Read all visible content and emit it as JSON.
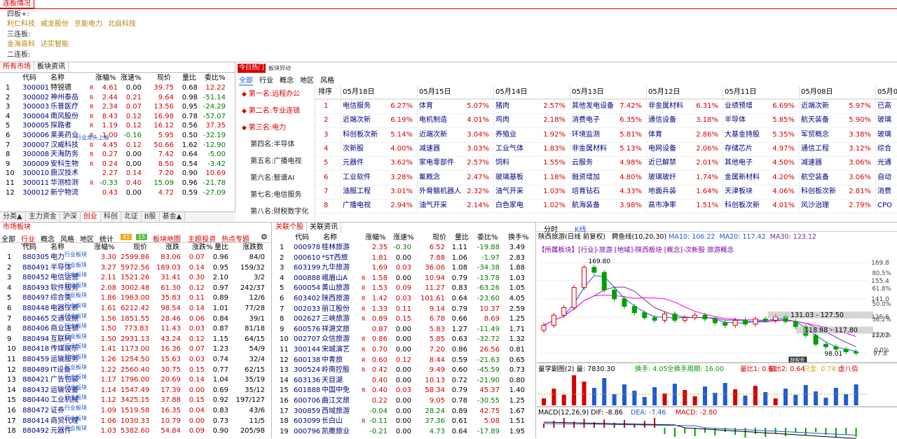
{
  "lianban": {
    "title": "连板情况",
    "rows": [
      {
        "label": "四板+:",
        "stocks": [
          "利仁科技",
          "威龙股份",
          "京能电力",
          "北自科技"
        ]
      },
      {
        "label": "三连板:",
        "stocks": [
          "金海高科",
          "达实智能"
        ]
      },
      {
        "label": "二连板:",
        "stocks": []
      }
    ]
  },
  "market": {
    "tabs": [
      "所有市场",
      "板块资讯"
    ],
    "headers": [
      "代码",
      "名称",
      "涨幅%",
      "涨速%",
      "现价",
      "量比",
      "委比%"
    ],
    "rows": [
      [
        "1",
        "300001",
        "特锐德",
        "R",
        "4.61",
        "0.00",
        "39.75",
        "0.68",
        "12.22"
      ],
      [
        "2",
        "300002",
        "神州泰岳",
        "R",
        "2.44",
        "0.21",
        "9.64",
        "0.98",
        "-51.14"
      ],
      [
        "3",
        "300003",
        "乐普医疗",
        "R",
        "2.34",
        "0.07",
        "13.56",
        "0.95",
        "-24.29"
      ],
      [
        "4",
        "300004",
        "南风股份",
        "R",
        "8.43",
        "0.12",
        "16.98",
        "0.78",
        "-57.07"
      ],
      [
        "5",
        "300005",
        "探路者",
        "R",
        "1.19",
        "0.12",
        "16.12",
        "0.56",
        "37.35"
      ],
      [
        "6",
        "300006",
        "莱美药业",
        "R",
        "1.00",
        "-0.16",
        "5.95",
        "0.50",
        "-32.19"
      ],
      [
        "7",
        "300007",
        "汉威科技",
        "R",
        "4.45",
        "0.12",
        "50.66",
        "1.62",
        "-12.90"
      ],
      [
        "8",
        "300008",
        "天海防务",
        "R",
        "0.27",
        "0.00",
        "7.42",
        "0.64",
        "-5.00"
      ],
      [
        "9",
        "300009",
        "安科生物",
        "R",
        "0.24",
        "0.00",
        "8.50",
        "0.54",
        "-3.42"
      ],
      [
        "10",
        "300010",
        "鼎汉技术",
        "",
        "2.27",
        "0.14",
        "7.20",
        "0.90",
        "10.69"
      ],
      [
        "11",
        "300011",
        "华测检测",
        "R",
        "-0.33",
        "0.40",
        "15.09",
        "0.96",
        "-21.78"
      ],
      [
        "12",
        "300012",
        "新宁物流",
        "",
        "0.43",
        "0.00",
        "4.72",
        "0.59",
        "-27.09"
      ]
    ],
    "hot_tag": "行业龙头上板",
    "bottom_tabs": [
      "分类▲",
      "主力资金",
      "沪深",
      "创业",
      "科创",
      "北证",
      "B股",
      "基金▲"
    ]
  },
  "hot": {
    "tab_active": "今日热门",
    "tab_other": "板块异动",
    "filters": [
      "全部",
      "行业",
      "概念",
      "地区",
      "风格"
    ],
    "ranks": [
      "第一名:远程办公",
      "第二名:专业连锁",
      "第三名:电力",
      "第四名:半导体",
      "第五名:广播电视",
      "第六名:智谱AI",
      "第七名:电信服务",
      "第八名:财税数字化"
    ],
    "rank_header": "排序",
    "dates": [
      "05月18日",
      "05月15日",
      "05月14日",
      "05月13日",
      "05月12日",
      "05月11日",
      "05月08日",
      "05月0"
    ],
    "rows": [
      [
        [
          "电信服务",
          "6.27%"
        ],
        [
          "体育",
          "5.07%"
        ],
        [
          "猪肉",
          "2.57%"
        ],
        [
          "其他发电设备",
          "7.42%"
        ],
        [
          "非金属材料",
          "6.31%"
        ],
        [
          "业绩预增",
          "6.69%"
        ],
        [
          "近端次新",
          "5.97%"
        ],
        [
          "已高"
        ]
      ],
      [
        [
          "近端次新",
          "6.19%"
        ],
        [
          "电机制造",
          "4.01%"
        ],
        [
          "鸡肉",
          "2.18%"
        ],
        [
          "消费电子",
          "6.35%"
        ],
        [
          "通信设备",
          "3.18%"
        ],
        [
          "半导体",
          "5.85%"
        ],
        [
          "航天装备",
          "5.90%"
        ],
        [
          "玻璃"
        ]
      ],
      [
        [
          "科创板次新",
          "5.14%"
        ],
        [
          "近端次新",
          "3.04%"
        ],
        [
          "养殖业",
          "1.92%"
        ],
        [
          "环境监测",
          "5.81%"
        ],
        [
          "体育",
          "2.86%"
        ],
        [
          "大基金持股",
          "5.35%"
        ],
        [
          "军贸概念",
          "3.38%"
        ],
        [
          "玻璃"
        ]
      ],
      [
        [
          "次新股",
          "4.00%"
        ],
        [
          "减速器",
          "3.03%"
        ],
        [
          "工业气体",
          "1.83%"
        ],
        [
          "非金属材料",
          "5.13%"
        ],
        [
          "电网设备",
          "2.06%"
        ],
        [
          "存储芯片",
          "4.97%"
        ],
        [
          "通信工程",
          "3.12%"
        ],
        [
          "综合"
        ]
      ],
      [
        [
          "元器件",
          "3.62%"
        ],
        [
          "家电零部件",
          "2.57%"
        ],
        [
          "饲料",
          "1.55%"
        ],
        [
          "云服务",
          "4.98%"
        ],
        [
          "近已解禁",
          "2.01%"
        ],
        [
          "其他电子",
          "4.50%"
        ],
        [
          "减速器",
          "3.06%"
        ],
        [
          "光通"
        ]
      ],
      [
        [
          "工业软件",
          "3.28%"
        ],
        [
          "氟概念",
          "2.47%"
        ],
        [
          "玻璃基板",
          "1.18%"
        ],
        [
          "融资增加",
          "4.80%"
        ],
        [
          "玻璃玻纤",
          "1.74%"
        ],
        [
          "金属新材料",
          "4.20%"
        ],
        [
          "航空装备",
          "3.06%"
        ],
        [
          "自动"
        ]
      ],
      [
        [
          "油服工程",
          "3.01%"
        ],
        [
          "外骨骼机器人",
          "2.32%"
        ],
        [
          "油气开采",
          "1.03%"
        ],
        [
          "培育钻石",
          "4.33%"
        ],
        [
          "地面兵装",
          "1.64%"
        ],
        [
          "天津板块",
          "4.06%"
        ],
        [
          "科创板次新",
          "2.81%"
        ],
        [
          "消费"
        ]
      ],
      [
        [
          "广播电视",
          "2.94%"
        ],
        [
          "油气开采",
          "2.14%"
        ],
        [
          "白色家电",
          "1.02%"
        ],
        [
          "航海装备",
          "3.98%"
        ],
        [
          "高市净率",
          "1.51%"
        ],
        [
          "科创板次新",
          "4.01%"
        ],
        [
          "风沙治理",
          "2.79%"
        ],
        [
          "CPO"
        ]
      ]
    ]
  },
  "sector": {
    "title": "市场板块",
    "tabs": [
      "全部",
      "行业",
      "概念",
      "风格",
      "地区",
      "统计"
    ],
    "counts": [
      "41",
      "15"
    ],
    "links": [
      "板块地图",
      "主题投资",
      "热点专题"
    ],
    "headers": [
      "代码",
      "名称",
      "涨幅%",
      "现价",
      "涨跌",
      "涨跌%",
      "量比",
      "涨跌数"
    ],
    "tag": "行业板块",
    "rows": [
      [
        "1",
        "880305",
        "电力",
        "3.30",
        "2599.86",
        "83.06",
        "0.07",
        "0.96",
        "84/0"
      ],
      [
        "2",
        "880491",
        "半导体",
        "3.27",
        "5972.56",
        "189.03",
        "0.14",
        "0.95",
        "159/32"
      ],
      [
        "3",
        "880452",
        "电信运营",
        "2.11",
        "1521.26",
        "31.41",
        "0.30",
        "2.10",
        "3/2"
      ],
      [
        "4",
        "880493",
        "软件服务",
        "2.08",
        "3002.48",
        "61.30",
        "0.12",
        "0.97",
        "242/37"
      ],
      [
        "5",
        "880497",
        "综合类",
        "1.86",
        "1963.00",
        "35.83",
        "0.11",
        "0.89",
        "12/6"
      ],
      [
        "6",
        "880448",
        "电器仪表",
        "1.61",
        "6212.42",
        "98.54",
        "0.14",
        "1.01",
        "77/28"
      ],
      [
        "7",
        "880465",
        "交通设施",
        "1.56",
        "1851.55",
        "28.46",
        "0.06",
        "0.84",
        "39/1"
      ],
      [
        "8",
        "880406",
        "商业连锁",
        "1.50",
        "773.83",
        "11.43",
        "0.03",
        "0.87",
        "81/18"
      ],
      [
        "9",
        "880494",
        "互联网",
        "1.50",
        "2931.13",
        "43.24",
        "0.12",
        "1.15",
        "64/15"
      ],
      [
        "10",
        "880418",
        "传媒娱乐",
        "1.41",
        "1173.00",
        "16.36",
        "0.07",
        "1.23",
        "54/9"
      ],
      [
        "11",
        "880459",
        "运输服务",
        "1.26",
        "1254.50",
        "15.63",
        "0.03",
        "0.74",
        "32/4"
      ],
      [
        "12",
        "880489",
        "IT设备",
        "1.22",
        "2560.40",
        "30.75",
        "0.15",
        "0.77",
        "62/15"
      ],
      [
        "13",
        "880421",
        "广告包装",
        "1.17",
        "1796.00",
        "20.69",
        "0.14",
        "1.04",
        "35/19"
      ],
      [
        "14",
        "880432",
        "运输设备",
        "1.14",
        "1547.49",
        "17.39",
        "0.00",
        "0.69",
        "35/12"
      ],
      [
        "15",
        "880440",
        "工业机械",
        "1.12",
        "3425.15",
        "37.88",
        "0.15",
        "0.92",
        "197/127"
      ],
      [
        "16",
        "880472",
        "证券",
        "1.09",
        "1519.58",
        "16.35",
        "0.04",
        "0.83",
        "43/6"
      ],
      [
        "17",
        "880414",
        "商贸代理",
        "1.06",
        "1030.33",
        "10.79",
        "0.00",
        "0.73",
        "11/5"
      ],
      [
        "18",
        "880492",
        "元器件",
        "1.03",
        "5382.60",
        "54.84",
        "0.09",
        "0.90",
        "205/98"
      ]
    ]
  },
  "related": {
    "tabs": [
      "关联个股",
      "关联资讯"
    ],
    "headers": [
      "代码",
      "名称",
      "涨幅%",
      "涨速%",
      "现价",
      "量比",
      "委比%",
      "换手%"
    ],
    "rows": [
      [
        "1",
        "000978",
        "桂林旅游",
        "",
        "2.35",
        "-0.30",
        "6.52",
        "1.11",
        "-19.88",
        "3.49"
      ],
      [
        "2",
        "000610",
        "*ST西旅",
        "",
        "1.81",
        "0.00",
        "7.88",
        "1.06",
        "-1.97",
        "2.83"
      ],
      [
        "3",
        "603199",
        "九华旅游",
        "",
        "1.69",
        "0.03",
        "36.06",
        "1.08",
        "-34.38",
        "1.88"
      ],
      [
        "4",
        "000888",
        "峨眉山A",
        "R",
        "1.58",
        "0.00",
        "10.94",
        "0.79",
        "-13.78",
        "1.03"
      ],
      [
        "5",
        "600054",
        "黄山旅游",
        "R",
        "1.53",
        "0.09",
        "11.27",
        "0.83",
        "-63.26",
        "1.05"
      ],
      [
        "6",
        "603402",
        "陕西旅游",
        "R",
        "1.42",
        "0.03",
        "101.61",
        "0.64",
        "-23.60",
        "4.05"
      ],
      [
        "7",
        "002033",
        "丽江股份",
        "R",
        "1.33",
        "0.11",
        "9.14",
        "0.79",
        "10.37",
        "2.59"
      ],
      [
        "8",
        "002627",
        "三峡旅游",
        "R",
        "0.89",
        "0.15",
        "6.78",
        "0.66",
        "8.69",
        "1.25"
      ],
      [
        "9",
        "600576",
        "祥源文旅",
        "",
        "0.87",
        "0.00",
        "5.83",
        "1.27",
        "-11.49",
        "1.71"
      ],
      [
        "10",
        "002707",
        "众信旅游",
        "R",
        "0.86",
        "0.00",
        "5.85",
        "0.63",
        "-32.72",
        "1.32"
      ],
      [
        "11",
        "300144",
        "宋城演艺",
        "R",
        "0.70",
        "0.00",
        "7.20",
        "0.86",
        "26.56",
        "0.81"
      ],
      [
        "12",
        "600138",
        "中青旅",
        "R",
        "0.60",
        "0.12",
        "8.44",
        "0.59",
        "-21.63",
        "0.65"
      ],
      [
        "13",
        "300524",
        "岭南控股",
        "R",
        "0.42",
        "0.00",
        "9.49",
        "0.60",
        "-45.59",
        "0.73"
      ],
      [
        "14",
        "603136",
        "天目湖",
        "",
        "0.40",
        "0.00",
        "10.13",
        "0.72",
        "-21.90",
        "0.80"
      ],
      [
        "15",
        "601888",
        "中国中免",
        "R",
        "0.40",
        "0.03",
        "58.34",
        "0.79",
        "45.37",
        "1.40"
      ],
      [
        "16",
        "600706",
        "曲江文旅",
        "",
        "0.22",
        "0.00",
        "9.05",
        "0.78",
        "-30.55",
        "1.25"
      ],
      [
        "17",
        "300859",
        "西域旅游",
        "",
        "-0.04",
        "0.00",
        "28.24",
        "0.89",
        "42.75",
        "1.67"
      ],
      [
        "18",
        "603099",
        "长白山",
        "R",
        "-0.11",
        "0.00",
        "37.36",
        "0.61",
        "5.08",
        "1.51"
      ],
      [
        "19",
        "000796",
        "凯撒旅业",
        "",
        "-0.21",
        "0.00",
        "4.73",
        "0.64",
        "-17.89",
        "1.95"
      ]
    ]
  },
  "chart": {
    "tabs": [
      "分时",
      "K线"
    ],
    "title": "陕西旅游(日线 前复权)",
    "ma_label": "鳄鱼线(10,20,30)",
    "ma10": "MA10: 106.22",
    "ma20": "MA20: 117.42",
    "ma30": "MA30: 123.12",
    "tags": "【所属板块】[行业]-旅游 [地域]-陕西板块 [概念]-次新股 旅游概念",
    "price_ticks": [
      "169.8",
      "155.4",
      "141.0",
      "126.6",
      "112.2",
      "97.8"
    ],
    "pct_ticks": [
      "80.5%",
      "61.8%",
      "50.0%",
      "38.2%",
      "23.6%",
      "0.0%"
    ],
    "boxes": [
      "131.03 - 127.50",
      "118.88 - 117.80"
    ],
    "high": "169.80",
    "low": "98.01",
    "small_label": "财税务",
    "vol_title": "量学副图(2) 量: 7830.30",
    "vol_items": [
      "换手: 4.05",
      "全换手周期: 16.00",
      "量比1: 0.61",
      "量比2: 0.64",
      "只金: 0.74",
      "虚八佰"
    ],
    "macd": "MACD(12,26,9) DIF: -8.86",
    "dea": "DEA: -7.46",
    "macd_val": "MACD: -2.80",
    "closes": [
      120,
      128,
      134,
      150,
      166,
      162,
      148,
      141,
      135,
      130,
      126,
      124,
      129,
      124,
      126,
      128,
      125,
      122,
      120,
      124,
      121,
      125,
      124,
      127,
      123,
      119,
      112,
      105,
      103,
      101,
      99,
      98
    ],
    "colors": {
      "up": "#d40000",
      "down": "#00a000",
      "ma10": "#1e5bd6",
      "ma20": "#7a2aa0",
      "ma30": "#ff00ff"
    }
  }
}
